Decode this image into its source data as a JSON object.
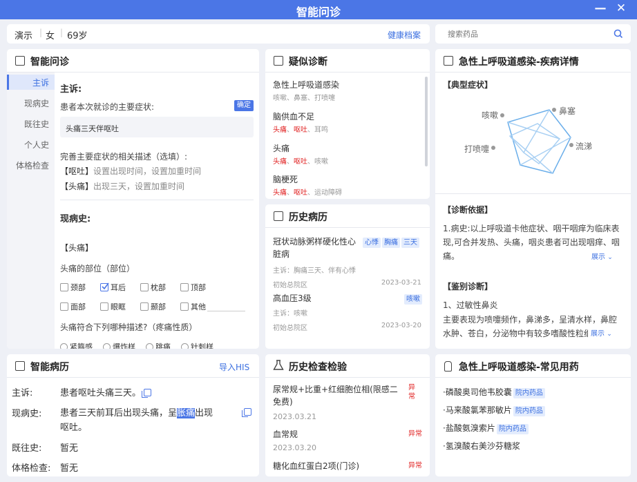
{
  "window": {
    "title": "智能问诊",
    "minimize": "—",
    "close": "✕"
  },
  "patient": {
    "name": "演示",
    "gender": "女",
    "age": "69岁",
    "health_record_link": "健康档案"
  },
  "drug_search": {
    "placeholder": "搜索药品"
  },
  "inquiry": {
    "title": "智能问诊",
    "tabs": [
      "主诉",
      "现病史",
      "既往史",
      "个人史",
      "体格检查"
    ],
    "chief_heading": "主诉:",
    "chief_prompt": "患者本次就诊的主要症状:",
    "confirm": "确定",
    "chief_value": "头痛三天伴呕吐",
    "improve_prompt": "完善主要症状的相关描述（选填）:",
    "improve_items": [
      {
        "tag": "【呕吐】",
        "text": "设置出现时间，设置加重时间"
      },
      {
        "tag": "【头痛】",
        "text": "出现三天，设置加重时间"
      }
    ],
    "present_heading": "现病史:",
    "present_tag": "【头痛】",
    "location_q": "头痛的部位（部位）",
    "locations": [
      "颈部",
      "耳后",
      "枕部",
      "顶部",
      "面部",
      "眼眶",
      "颞部",
      "其他"
    ],
    "checked_location": "耳后",
    "desc_q": "头痛符合下列哪种描述?（疼痛性质）",
    "desc_options": [
      "紧箍感",
      "爆炸样",
      "跳痛",
      "针刺样"
    ]
  },
  "diagnosis": {
    "title": "疑似诊断",
    "items": [
      {
        "name": "急性上呼吸道感染",
        "symptoms": [
          {
            "t": "咳嗽",
            "hit": false
          },
          {
            "t": "鼻塞",
            "hit": false
          },
          {
            "t": "打喷嚏",
            "hit": false
          }
        ]
      },
      {
        "name": "脑供血不足",
        "symptoms": [
          {
            "t": "头痛",
            "hit": true
          },
          {
            "t": "呕吐",
            "hit": true
          },
          {
            "t": "耳鸣",
            "hit": false
          }
        ]
      },
      {
        "name": "头痛",
        "symptoms": [
          {
            "t": "头痛",
            "hit": true
          },
          {
            "t": "呕吐",
            "hit": true
          },
          {
            "t": "咳嗽",
            "hit": false
          }
        ]
      },
      {
        "name": "脑梗死",
        "symptoms": [
          {
            "t": "头痛",
            "hit": true
          },
          {
            "t": "呕吐",
            "hit": true
          },
          {
            "t": "运动障碍",
            "hit": false
          }
        ]
      }
    ]
  },
  "disease_detail": {
    "title": "急性上呼吸道感染-疾病详情",
    "typical_heading": "【典型症状】",
    "radar_labels": [
      "咳嗽",
      "鼻塞",
      "打喷嚏",
      "流涕"
    ],
    "basis_heading": "【诊断依据】",
    "basis_text": "1.病史:以上呼吸道卡他症状、咽干咽痒为临床表现,可合并发热、头痛，咽炎患者可出现咽痒、咽痛。",
    "expand": "展示",
    "differential_heading": "【鉴别诊断】",
    "differential_title": "1、过敏性鼻炎",
    "differential_text": "主要表现为喷嚏频作，鼻涕多，呈清水样，鼻腔水肿、苍白，分泌物中有较多嗜酸性粒细胞",
    "expand2": "展示"
  },
  "history": {
    "title": "历史病历",
    "records": [
      {
        "name": "冠状动脉粥样硬化性心脏病",
        "tags": [
          "心悸",
          "胸痛",
          "三天"
        ],
        "chief": "主诉：胸痛三天、伴有心悸",
        "visit": "初始总院区",
        "date": "2023-03-21"
      },
      {
        "name": "高血压3级",
        "tags": [
          "咳嗽"
        ],
        "chief": "主诉：咳嗽",
        "visit": "初始总院区",
        "date": "2023-03-20"
      }
    ]
  },
  "smart_record": {
    "title": "智能病历",
    "import": "导入HIS",
    "rows": [
      {
        "label": "主诉:",
        "value": "患者呕吐头痛三天。"
      },
      {
        "label": "现病史:",
        "value_a": "患者三天前耳后出现头痛，呈",
        "value_hl": "胀痛",
        "value_b": "出现",
        "value_c": "呕吐。"
      },
      {
        "label": "既往史:",
        "value": "暂无"
      },
      {
        "label": "体格检查:",
        "value": "暂无"
      }
    ]
  },
  "exams": {
    "title": "历史检查检验",
    "items": [
      {
        "name": "尿常规+比重+红细胞位相(限感二免费)",
        "status": "异常",
        "date": "2023.03.21"
      },
      {
        "name": "血常规",
        "status": "异常",
        "date": "2023.03.20"
      },
      {
        "name": "糖化血红蛋白2项(门诊)",
        "status": "异常",
        "date": ""
      }
    ]
  },
  "drugs": {
    "title": "急性上呼吸道感染-常见用药",
    "items": [
      {
        "name": "·磷酸奥司他韦胶囊",
        "tag": "院内药品"
      },
      {
        "name": "·马来酸氯苯那敏片",
        "tag": "院内药品"
      },
      {
        "name": "·盐酸氨溴索片",
        "tag": "院内药品"
      },
      {
        "name": "·氢溴酸右美沙芬糖浆",
        "tag": ""
      }
    ]
  },
  "colors": {
    "accent": "#4b76e6",
    "abnormal": "#e02020",
    "tag_bg": "#e3ecfd"
  }
}
